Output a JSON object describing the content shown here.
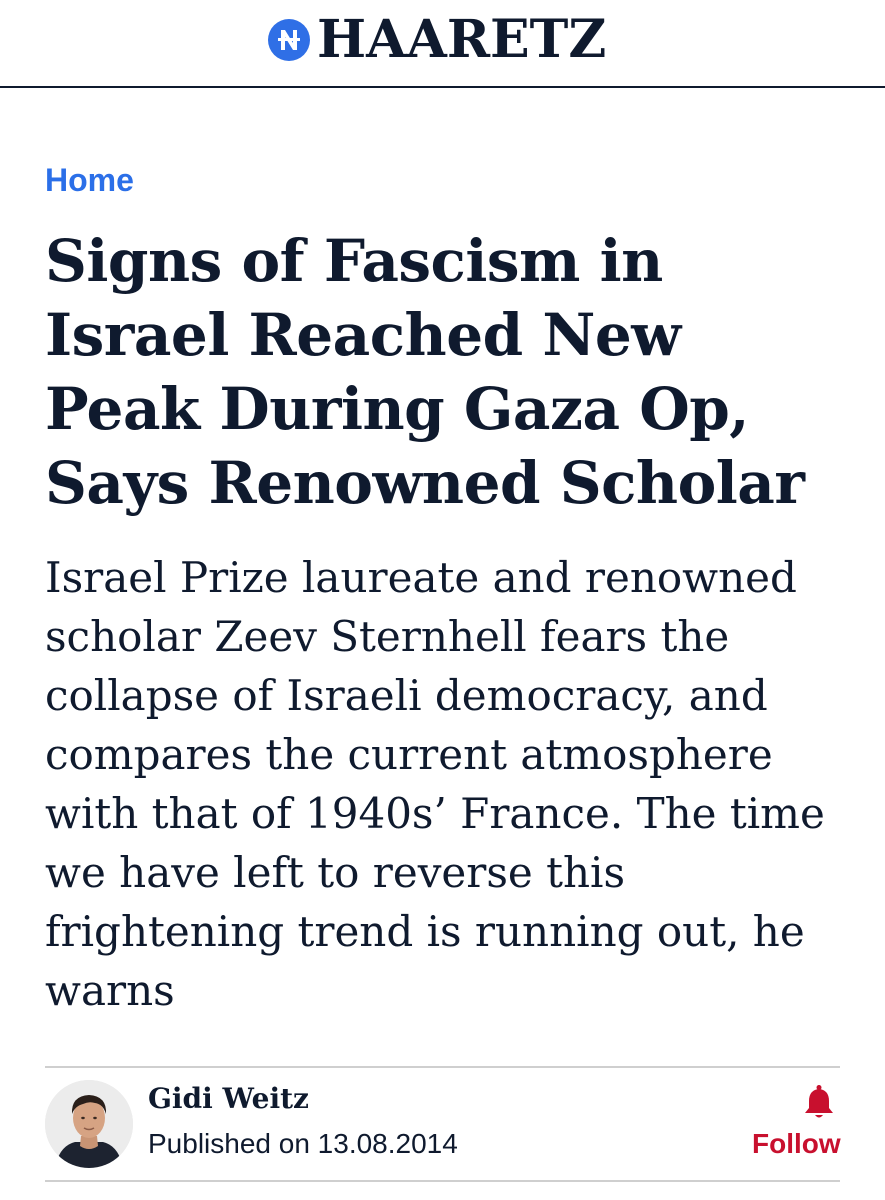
{
  "masthead": {
    "logo_text": "HAARETZ",
    "logo_icon": "haaretz-logo-mark",
    "logo_color": "#2f6fe6"
  },
  "breadcrumb": {
    "label": "Home",
    "color": "#2b6fe8"
  },
  "article": {
    "headline": "Signs of Fascism in Israel Reached New Peak During Gaza Op, Says Renowned Scholar",
    "subheadline": "Israel Prize laureate and renowned scholar Zeev Sternhell fears the collapse of Israeli democracy, and compares the current atmosphere with that of 1940s’ France. The time we have left to reverse this frightening trend is running out, he warns"
  },
  "byline": {
    "author_name": "Gidi Weitz",
    "published": "Published on 13.08.2014",
    "follow_label": "Follow",
    "follow_icon": "bell-icon",
    "follow_color": "#c8102e"
  }
}
